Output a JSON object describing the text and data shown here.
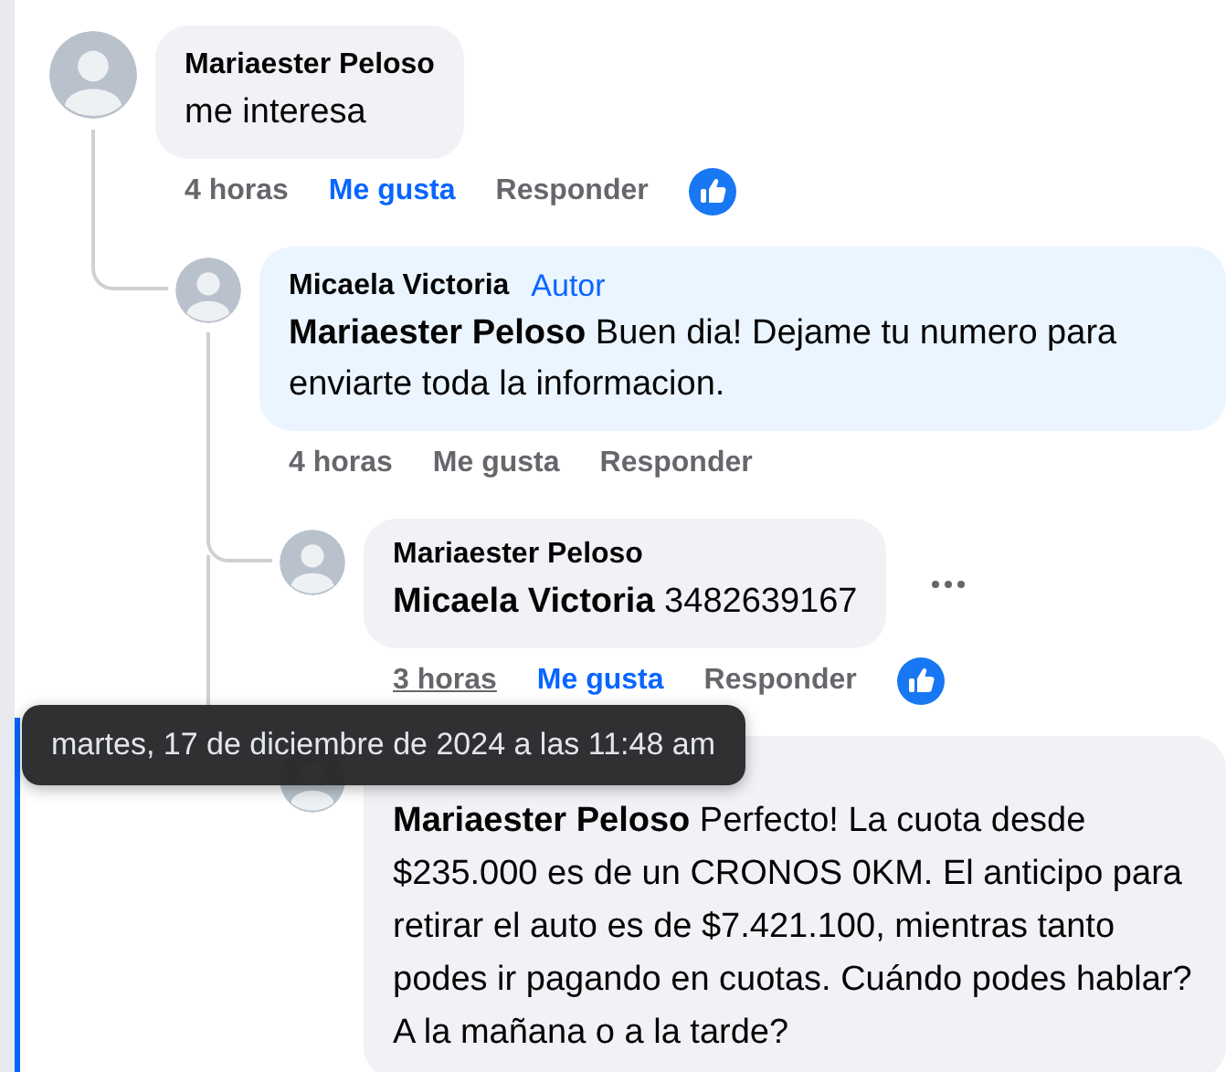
{
  "comments": [
    {
      "author": "Mariaester Peloso",
      "text": "me interesa",
      "time": "4 horas",
      "time_hovered": false,
      "like": "Me gusta",
      "liked": true,
      "reply": "Responder",
      "has_reaction": true,
      "children": [
        {
          "author": "Micaela Victoria",
          "badge": "Autor",
          "text": "**Mariaester Peloso** Buen dia! Dejame tu numero para enviarte toda la informacion.",
          "time": "4 horas",
          "time_hovered": false,
          "like": "Me gusta",
          "liked": false,
          "reply": "Responder",
          "children": [
            {
              "author": "Mariaester Peloso",
              "text": "**Micaela Victoria** 3482639167",
              "show_menu": true,
              "time": "3 horas",
              "time_hovered": true,
              "like": "Me gusta",
              "liked": true,
              "reply": "Responder",
              "has_reaction": true
            },
            {
              "text": "**Mariaester Peloso** Perfecto! La cuota desde $235.000 es de un CRONOS 0KM. El anticipo para retirar el auto es de $7.421.100, mientras tanto podes ir pagando en cuotas. Cuándo podes hablar? A la mañana o a la tarde?",
              "focused": true
            }
          ]
        }
      ]
    }
  ],
  "tooltip": "martes, 17 de diciembre de 2024 a las 11:48 am"
}
